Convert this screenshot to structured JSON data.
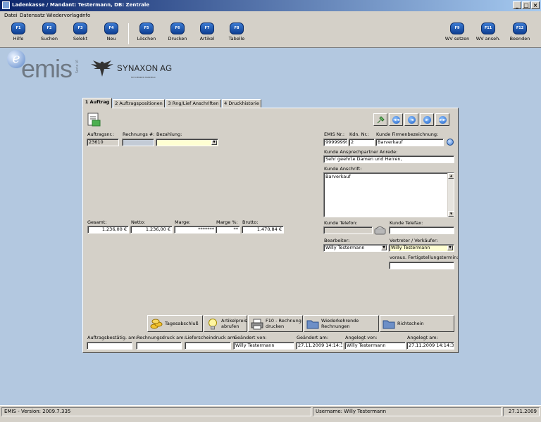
{
  "window": {
    "title": "Ladenkasse / Mandant: Testermann, DB: Zentrale",
    "minimize": "_",
    "maximize": "□",
    "close": "×"
  },
  "menu": [
    "Datei",
    "Datensatz",
    "Wiedervorlage",
    "Info"
  ],
  "toolbar": [
    {
      "key": "F1",
      "label": "Hilfe"
    },
    {
      "key": "F2",
      "label": "Suchen"
    },
    {
      "key": "F3",
      "label": "Selekt"
    },
    {
      "key": "F4",
      "label": "Neu"
    },
    {
      "key": "F5",
      "label": "Löschen"
    },
    {
      "key": "F6",
      "label": "Drucken"
    },
    {
      "key": "F7",
      "label": "Artikel"
    },
    {
      "key": "F8",
      "label": "Tabelle"
    },
    {
      "key": "F9",
      "label": "WV setzen"
    },
    {
      "key": "F11",
      "label": "WV anseh."
    },
    {
      "key": "F12",
      "label": "Beenden"
    }
  ],
  "logos": {
    "emis": "emis",
    "e": "e",
    "emis_sub": "Serie VI",
    "synaxon": "SYNAXON AG",
    "synaxon_tag": "MIT DENKEN HANDELN"
  },
  "tabs": [
    "1 Auftrag",
    "2 Auftragspositionen",
    "3 Rng/Lief Anschriften",
    "4 Druckhistorie"
  ],
  "nav": [
    "◄◄",
    "◄",
    "►",
    "►►"
  ],
  "form": {
    "auftragsnr": {
      "label": "Auftragsnr.:",
      "value": "23610"
    },
    "rechnungsnr": {
      "label": "Rechnungs #:",
      "value": ""
    },
    "bezahlung": {
      "label": "Bezahlung:",
      "value": ""
    },
    "emis_nr": {
      "label": "EMIS Nr.:",
      "value": "99999999"
    },
    "kdn_nr": {
      "label": "Kdn. Nr.:",
      "value": "2"
    },
    "firma": {
      "label": "Kunde Firmenbezeichnung:",
      "value": "Barverkauf"
    },
    "anrede": {
      "label": "Kunde Ansprechpartner Anrede:",
      "value": "Sehr geehrte Damen und Herren,"
    },
    "anschrift": {
      "label": "Kunde Anschrift:",
      "value": "Barverkauf"
    },
    "telefon": {
      "label": "Kunde Telefon:",
      "value": ""
    },
    "telefax": {
      "label": "Kunde Telefax:",
      "value": ""
    },
    "bearbeiter": {
      "label": "Bearbeiter:",
      "value": "Willy Testermann"
    },
    "vertreter": {
      "label": "Vertreter / Verkäufer:",
      "value": "Willy Testermann"
    },
    "fertigstellung": {
      "label": "voraus. Fertigstellungstermin:",
      "value": ""
    },
    "gesamt": {
      "label": "Gesamt:",
      "value": "1.236,00 €"
    },
    "netto": {
      "label": "Netto:",
      "value": "1.236,00 €"
    },
    "marge": {
      "label": "Marge:",
      "value": "*******"
    },
    "marge_pct": {
      "label": "Marge %:",
      "value": "**"
    },
    "brutto": {
      "label": "Brutto:",
      "value": "1.470,84 €"
    }
  },
  "actions": [
    {
      "label": "Tagesabschluß"
    },
    {
      "label1": "Artikelpreis",
      "label2": "abrufen"
    },
    {
      "label1": "F10 - Rechnung",
      "label2": "drucken"
    },
    {
      "label1": "Wiederkehrende",
      "label2": "Rechnungen"
    },
    {
      "label": "Richtschein"
    }
  ],
  "footer": {
    "auftragsbest": {
      "label": "Auftragsbestätig. am:",
      "value": ""
    },
    "rechnungsdruck": {
      "label": "Rechnungsdruck am:",
      "value": ""
    },
    "lieferschein": {
      "label": "Lieferscheindruck am:",
      "value": ""
    },
    "geaendert_von": {
      "label": "Geändert von:",
      "value": "Willy Testermann"
    },
    "geaendert_am": {
      "label": "Geändert am:",
      "value": "27.11.2009 14:14:33"
    },
    "angelegt_von": {
      "label": "Angelegt von:",
      "value": "Willy Testermann"
    },
    "angelegt_am": {
      "label": "Angelegt am:",
      "value": "27.11.2009 14:14:32"
    }
  },
  "status": {
    "version": "EMIS - Version: 2009.7.335",
    "user": "Username: Willy Testermann",
    "date": "27.11.2009"
  },
  "colors": {
    "title_start": "#0a246a",
    "title_end": "#a6caf0",
    "workspace": "#b3c8e0",
    "required": "#ffffd2"
  }
}
